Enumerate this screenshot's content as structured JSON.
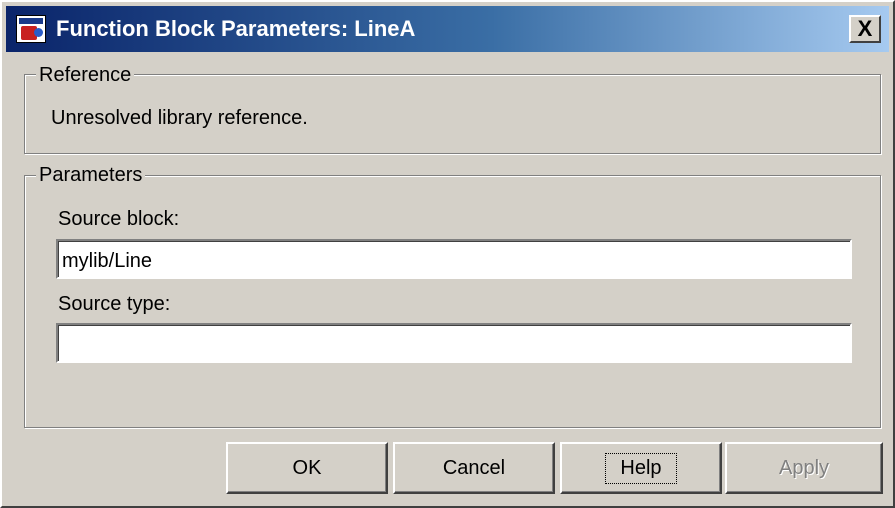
{
  "window": {
    "title": "Function Block Parameters: LineA",
    "close_glyph": "X"
  },
  "reference": {
    "legend": "Reference",
    "message": "Unresolved library reference."
  },
  "parameters": {
    "legend": "Parameters",
    "source_block_label": "Source block:",
    "source_block_value": "mylib/Line",
    "source_type_label": "Source type:",
    "source_type_value": ""
  },
  "buttons": {
    "ok": "OK",
    "cancel": "Cancel",
    "help": "Help",
    "apply": "Apply"
  },
  "colors": {
    "face": "#d4d0c8",
    "title_start": "#0a246a",
    "title_end": "#a6caf0",
    "disabled_text": "#808080"
  },
  "icons": {
    "app": "simulink-block-icon",
    "close": "close-icon"
  }
}
